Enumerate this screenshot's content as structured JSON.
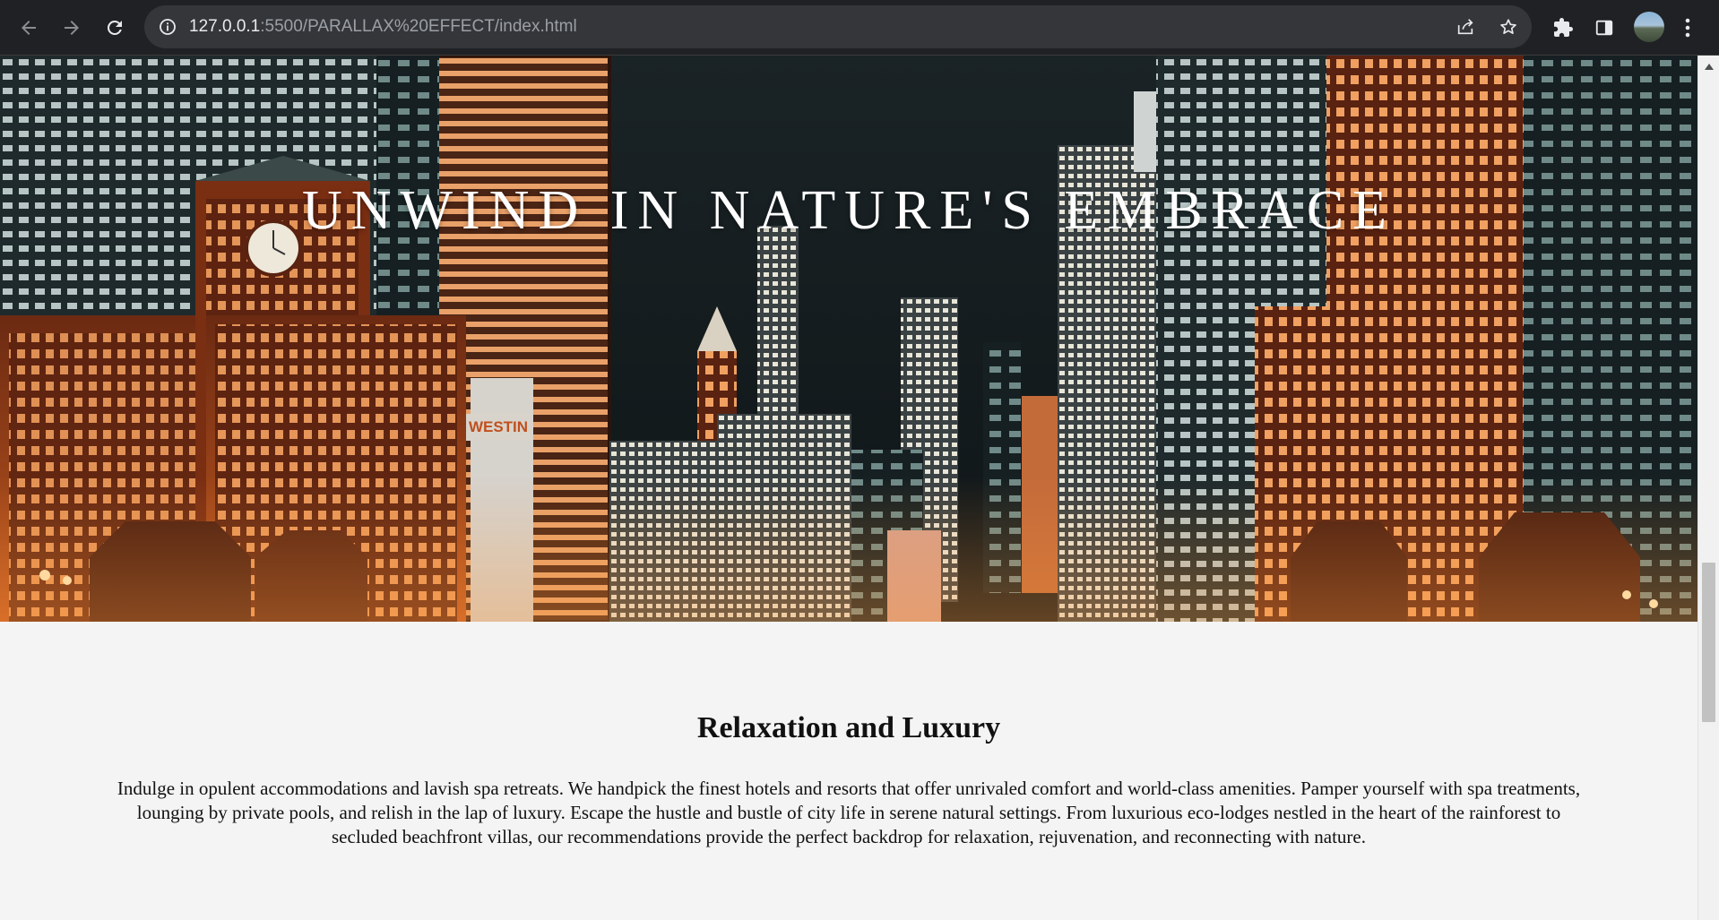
{
  "browser": {
    "url_host": "127.0.0.1",
    "url_path": ":5500/PARALLAX%20EFFECT/index.html",
    "icons": {
      "back": "arrow-left-icon",
      "forward": "arrow-right-icon",
      "reload": "reload-icon",
      "site_info": "info-icon",
      "share": "share-icon",
      "bookmark": "star-icon",
      "extensions": "puzzle-icon",
      "side_panel": "side-panel-icon",
      "profile": "avatar",
      "menu": "kebab-menu-icon"
    }
  },
  "hero": {
    "title": "UNWIND IN NATURE'S EMBRACE",
    "sign_text": "WESTIN"
  },
  "section": {
    "heading": "Relaxation and Luxury",
    "body": "Indulge in opulent accommodations and lavish spa retreats. We handpick the finest hotels and resorts that offer unrivaled comfort and world-class amenities. Pamper yourself with spa treatments, lounging by private pools, and relish in the lap of luxury. Escape the hustle and bustle of city life in serene natural settings. From luxurious eco-lodges nestled in the heart of the rainforest to secluded beachfront villas, our recommendations provide the perfect backdrop for relaxation, rejuvenation, and reconnecting with nature."
  },
  "colors": {
    "chrome_bg": "#202124",
    "omnibox_bg": "#35363a",
    "page_bg": "#f4f4f4",
    "hero_title": "#ffffff"
  }
}
